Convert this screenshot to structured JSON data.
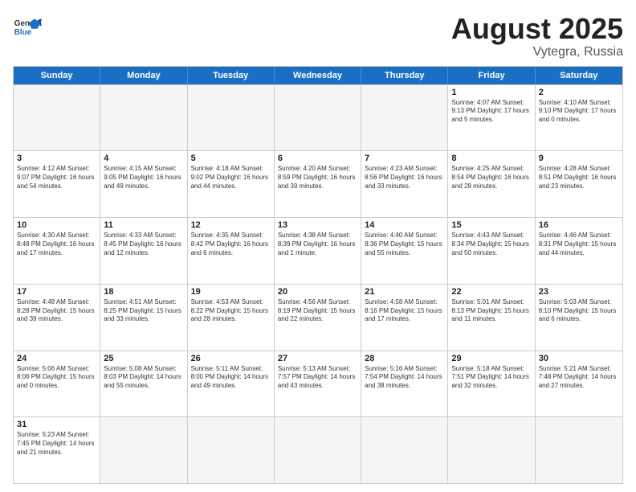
{
  "header": {
    "logo_general": "General",
    "logo_blue": "Blue",
    "title": "August 2025",
    "location": "Vytegra, Russia"
  },
  "days_of_week": [
    "Sunday",
    "Monday",
    "Tuesday",
    "Wednesday",
    "Thursday",
    "Friday",
    "Saturday"
  ],
  "weeks": [
    [
      {
        "day": "",
        "info": ""
      },
      {
        "day": "",
        "info": ""
      },
      {
        "day": "",
        "info": ""
      },
      {
        "day": "",
        "info": ""
      },
      {
        "day": "",
        "info": ""
      },
      {
        "day": "1",
        "info": "Sunrise: 4:07 AM\nSunset: 9:13 PM\nDaylight: 17 hours\nand 5 minutes."
      },
      {
        "day": "2",
        "info": "Sunrise: 4:10 AM\nSunset: 9:10 PM\nDaylight: 17 hours\nand 0 minutes."
      }
    ],
    [
      {
        "day": "3",
        "info": "Sunrise: 4:12 AM\nSunset: 9:07 PM\nDaylight: 16 hours\nand 54 minutes."
      },
      {
        "day": "4",
        "info": "Sunrise: 4:15 AM\nSunset: 9:05 PM\nDaylight: 16 hours\nand 49 minutes."
      },
      {
        "day": "5",
        "info": "Sunrise: 4:18 AM\nSunset: 9:02 PM\nDaylight: 16 hours\nand 44 minutes."
      },
      {
        "day": "6",
        "info": "Sunrise: 4:20 AM\nSunset: 8:59 PM\nDaylight: 16 hours\nand 39 minutes."
      },
      {
        "day": "7",
        "info": "Sunrise: 4:23 AM\nSunset: 8:56 PM\nDaylight: 16 hours\nand 33 minutes."
      },
      {
        "day": "8",
        "info": "Sunrise: 4:25 AM\nSunset: 8:54 PM\nDaylight: 16 hours\nand 28 minutes."
      },
      {
        "day": "9",
        "info": "Sunrise: 4:28 AM\nSunset: 8:51 PM\nDaylight: 16 hours\nand 23 minutes."
      }
    ],
    [
      {
        "day": "10",
        "info": "Sunrise: 4:30 AM\nSunset: 8:48 PM\nDaylight: 16 hours\nand 17 minutes."
      },
      {
        "day": "11",
        "info": "Sunrise: 4:33 AM\nSunset: 8:45 PM\nDaylight: 16 hours\nand 12 minutes."
      },
      {
        "day": "12",
        "info": "Sunrise: 4:35 AM\nSunset: 8:42 PM\nDaylight: 16 hours\nand 6 minutes."
      },
      {
        "day": "13",
        "info": "Sunrise: 4:38 AM\nSunset: 8:39 PM\nDaylight: 16 hours\nand 1 minute."
      },
      {
        "day": "14",
        "info": "Sunrise: 4:40 AM\nSunset: 8:36 PM\nDaylight: 15 hours\nand 55 minutes."
      },
      {
        "day": "15",
        "info": "Sunrise: 4:43 AM\nSunset: 8:34 PM\nDaylight: 15 hours\nand 50 minutes."
      },
      {
        "day": "16",
        "info": "Sunrise: 4:46 AM\nSunset: 8:31 PM\nDaylight: 15 hours\nand 44 minutes."
      }
    ],
    [
      {
        "day": "17",
        "info": "Sunrise: 4:48 AM\nSunset: 8:28 PM\nDaylight: 15 hours\nand 39 minutes."
      },
      {
        "day": "18",
        "info": "Sunrise: 4:51 AM\nSunset: 8:25 PM\nDaylight: 15 hours\nand 33 minutes."
      },
      {
        "day": "19",
        "info": "Sunrise: 4:53 AM\nSunset: 8:22 PM\nDaylight: 15 hours\nand 28 minutes."
      },
      {
        "day": "20",
        "info": "Sunrise: 4:56 AM\nSunset: 8:19 PM\nDaylight: 15 hours\nand 22 minutes."
      },
      {
        "day": "21",
        "info": "Sunrise: 4:58 AM\nSunset: 8:16 PM\nDaylight: 15 hours\nand 17 minutes."
      },
      {
        "day": "22",
        "info": "Sunrise: 5:01 AM\nSunset: 8:13 PM\nDaylight: 15 hours\nand 11 minutes."
      },
      {
        "day": "23",
        "info": "Sunrise: 5:03 AM\nSunset: 8:10 PM\nDaylight: 15 hours\nand 6 minutes."
      }
    ],
    [
      {
        "day": "24",
        "info": "Sunrise: 5:06 AM\nSunset: 8:06 PM\nDaylight: 15 hours\nand 0 minutes."
      },
      {
        "day": "25",
        "info": "Sunrise: 5:08 AM\nSunset: 8:03 PM\nDaylight: 14 hours\nand 55 minutes."
      },
      {
        "day": "26",
        "info": "Sunrise: 5:11 AM\nSunset: 8:00 PM\nDaylight: 14 hours\nand 49 minutes."
      },
      {
        "day": "27",
        "info": "Sunrise: 5:13 AM\nSunset: 7:57 PM\nDaylight: 14 hours\nand 43 minutes."
      },
      {
        "day": "28",
        "info": "Sunrise: 5:16 AM\nSunset: 7:54 PM\nDaylight: 14 hours\nand 38 minutes."
      },
      {
        "day": "29",
        "info": "Sunrise: 5:18 AM\nSunset: 7:51 PM\nDaylight: 14 hours\nand 32 minutes."
      },
      {
        "day": "30",
        "info": "Sunrise: 5:21 AM\nSunset: 7:48 PM\nDaylight: 14 hours\nand 27 minutes."
      }
    ],
    [
      {
        "day": "31",
        "info": "Sunrise: 5:23 AM\nSunset: 7:45 PM\nDaylight: 14 hours\nand 21 minutes."
      },
      {
        "day": "",
        "info": ""
      },
      {
        "day": "",
        "info": ""
      },
      {
        "day": "",
        "info": ""
      },
      {
        "day": "",
        "info": ""
      },
      {
        "day": "",
        "info": ""
      },
      {
        "day": "",
        "info": ""
      }
    ]
  ]
}
